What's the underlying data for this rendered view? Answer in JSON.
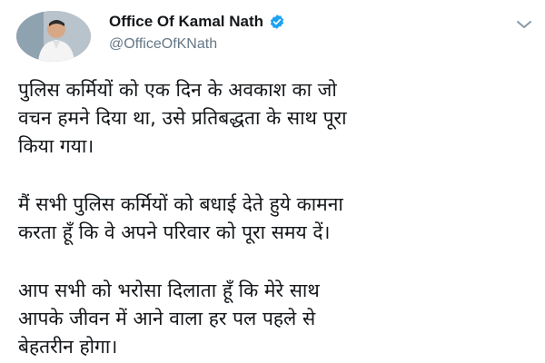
{
  "author": {
    "display_name": "Office Of Kamal Nath",
    "handle": "@OfficeOfKNath",
    "verified_badge_color": "#1da1f2",
    "verified_icon": "verified-check-icon"
  },
  "menu": {
    "icon": "chevron-down-icon"
  },
  "tweet": {
    "paragraphs": [
      "पुलिस कर्मियों को एक दिन के अवकाश का जो\nवचन हमने दिया था, उसे प्रतिबद्धता के साथ पूरा\nकिया गया।",
      "मैं सभी पुलिस कर्मियों को बधाई देते हुये कामना\nकरता हूँ कि वे अपने परिवार को पूरा समय दें।",
      "आप सभी को भरोसा दिलाता हूँ कि मेरे साथ\nआपके जीवन में आने वाला हर पल पहले से\nबेहतरीन होगा।"
    ]
  }
}
